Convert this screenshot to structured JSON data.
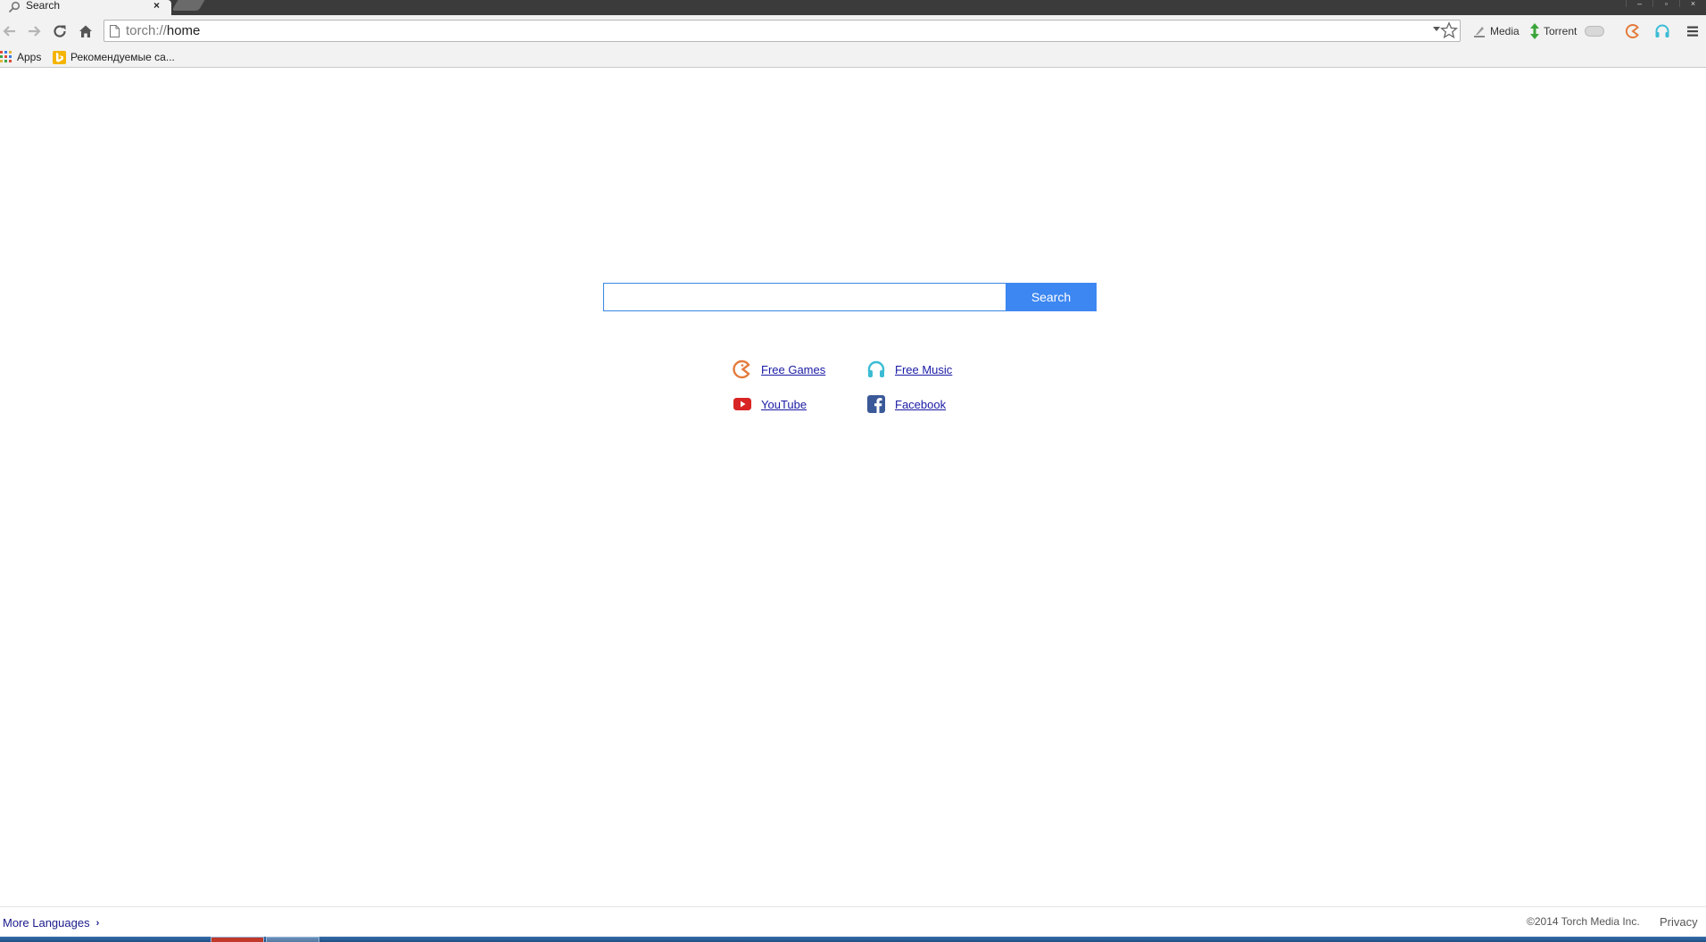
{
  "browser": {
    "tab": {
      "title": "Search",
      "close_glyph": "×"
    },
    "window_controls": [
      "–",
      "▫",
      "×"
    ],
    "toolbar": {
      "back_icon": "back-arrow-icon",
      "forward_icon": "forward-arrow-icon",
      "reload_icon": "reload-icon",
      "home_icon": "home-icon",
      "url_scheme": "torch://",
      "url_path": "home",
      "extensions": [
        {
          "label": "Media",
          "icon": "media-grab-icon"
        },
        {
          "label": "Torrent",
          "icon": "torrent-icon"
        }
      ]
    },
    "bookmarks": [
      {
        "label": "Apps",
        "icon": "apps-grid-icon"
      },
      {
        "label": "Рекомендуемые са...",
        "icon": "bing-icon"
      }
    ]
  },
  "search": {
    "input_value": "",
    "button_label": "Search",
    "accent_color": "#3d87f2"
  },
  "quick_links": [
    {
      "label": "Free Games",
      "icon": "games-pacman-icon",
      "color": "#e37b3c"
    },
    {
      "label": "Free Music",
      "icon": "headphones-icon",
      "color": "#3bbcd4"
    },
    {
      "label": "YouTube",
      "icon": "youtube-icon",
      "color": "#d82424"
    },
    {
      "label": "Facebook",
      "icon": "facebook-icon",
      "color": "#3b5998"
    }
  ],
  "footer": {
    "more_languages": "More Languages",
    "copyright": "©2014 Torch Media Inc.",
    "privacy": "Privacy"
  }
}
